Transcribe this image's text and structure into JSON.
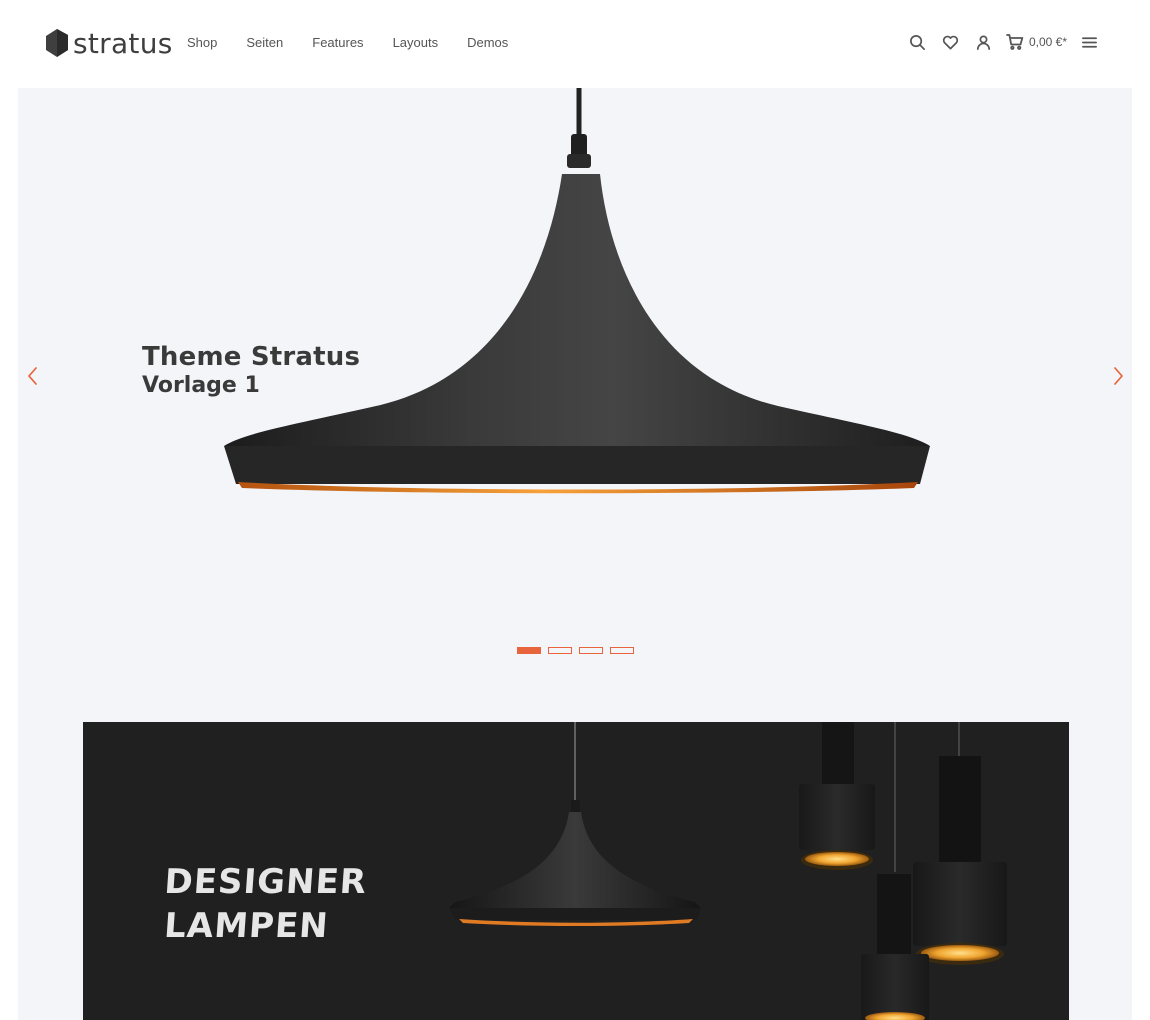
{
  "brand": {
    "name": "stratus",
    "accent": "#e8643c"
  },
  "nav": {
    "items": [
      "Shop",
      "Seiten",
      "Features",
      "Layouts",
      "Demos"
    ]
  },
  "header_actions": {
    "icons": [
      "search-icon",
      "heart-icon",
      "user-icon",
      "cart-icon",
      "menu-icon"
    ],
    "cart_total": "0,00 €*"
  },
  "hero": {
    "title": "Theme Stratus",
    "subtitle": "Vorlage 1",
    "slide_count": 4,
    "active_slide": 1
  },
  "banner": {
    "line1": "DESIGNER",
    "line2": "LAMPEN"
  }
}
